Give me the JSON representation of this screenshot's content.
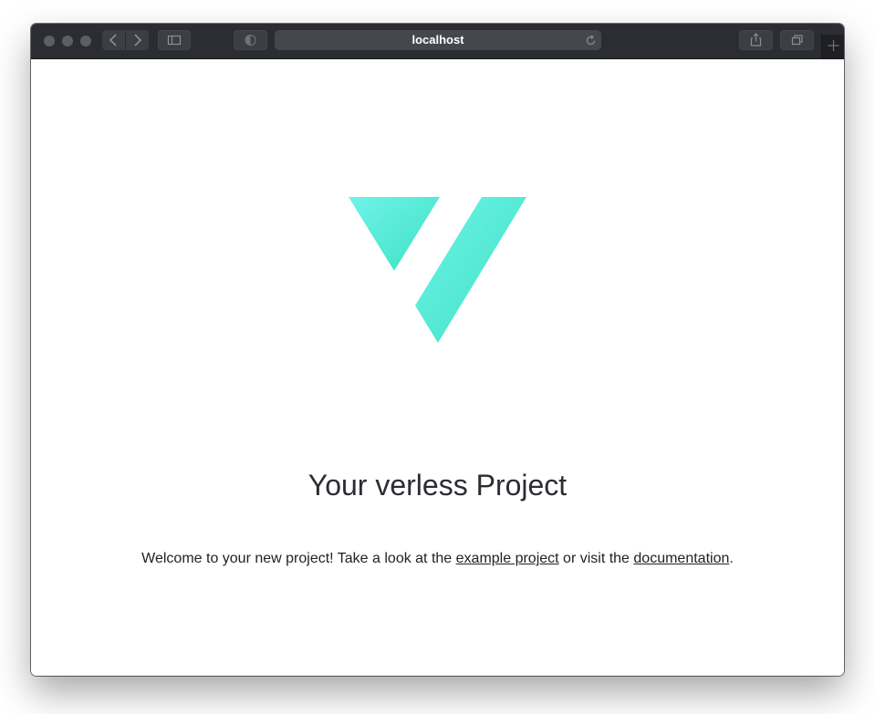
{
  "browser": {
    "address": "localhost",
    "toolbar_color": "#2b2d33"
  },
  "icons": {
    "back": "chevron-left-icon",
    "forward": "chevron-right-icon",
    "sidebar": "sidebar-icon",
    "privacy": "half-circle-icon",
    "reload": "reload-icon",
    "share": "share-icon",
    "tabs": "tabs-overview-icon",
    "new_tab": "plus-icon"
  },
  "page": {
    "title": "Your verless Project",
    "welcome_prefix": "Welcome to your new project! Take a look at the ",
    "example_link": "example project",
    "welcome_middle": " or visit the ",
    "docs_link": "documentation",
    "welcome_suffix": ".",
    "logo_colors": [
      "#6ff3ea",
      "#3ee1c0"
    ]
  }
}
